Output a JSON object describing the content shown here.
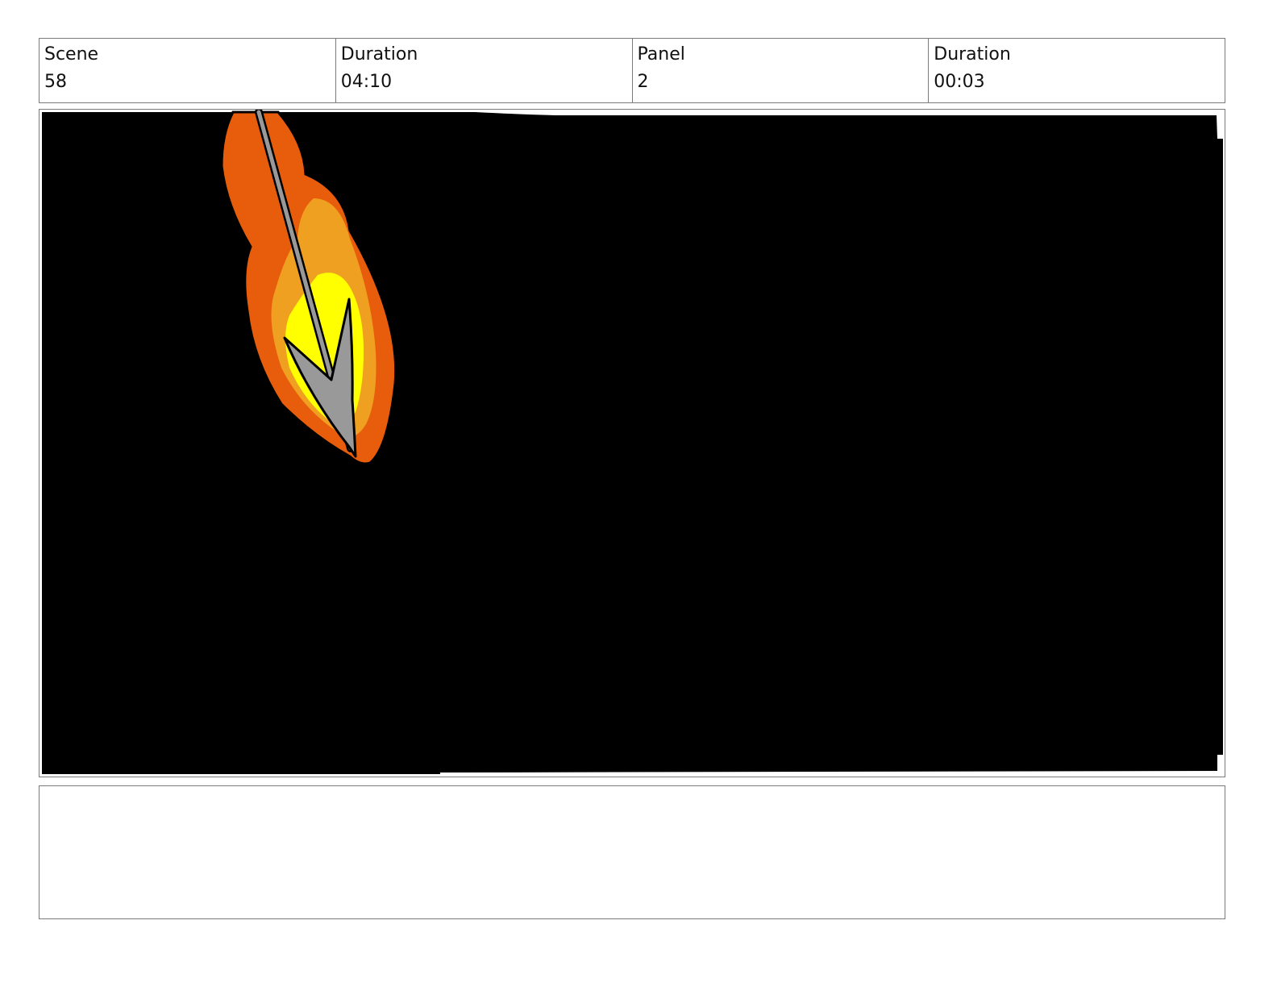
{
  "header": {
    "cells": [
      {
        "label": "Scene",
        "value": "58"
      },
      {
        "label": "Duration",
        "value": "04:10"
      },
      {
        "label": "Panel",
        "value": "2"
      },
      {
        "label": "Duration",
        "value": "00:03"
      }
    ]
  },
  "panel": {
    "background_color": "#000000",
    "flame_colors": [
      "#e85d0c",
      "#f0a020",
      "#ffff00"
    ],
    "arrow_color": "#999999"
  },
  "notes": {
    "text": ""
  }
}
